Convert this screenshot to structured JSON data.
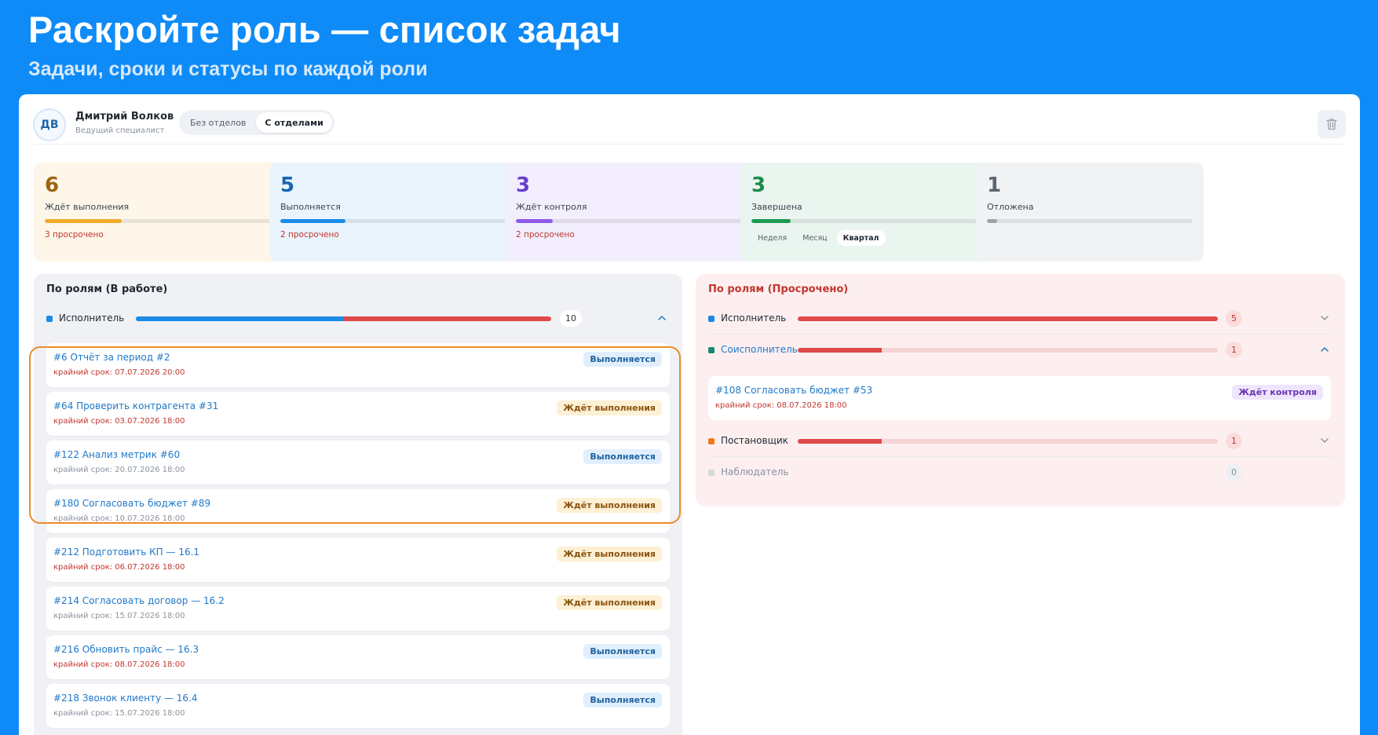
{
  "banner": {
    "title": "Раскройте роль — список задач",
    "subtitle": "Задачи, сроки и статусы по каждой роли"
  },
  "user": {
    "initials": "ДВ",
    "name": "Дмитрий Волков",
    "role": "Ведущий специалист"
  },
  "view_toggle": {
    "options": [
      "Без отделов",
      "С отделами"
    ],
    "selected": "С отделами"
  },
  "stats": [
    {
      "count": "6",
      "label": "Ждёт выполнения",
      "progress": 0.33,
      "overdue": "3 просрочено",
      "color": "#9c6512",
      "bar": "#f0ad2c",
      "bg": "#fdf6e9"
    },
    {
      "count": "5",
      "label": "Выполняется",
      "progress": 0.28,
      "overdue": "2 просрочено",
      "color": "#1a64b0",
      "bar": "#1a8be6",
      "bg": "#e9f4fd"
    },
    {
      "count": "3",
      "label": "Ждёт контроля",
      "progress": 0.16,
      "overdue": "2 просрочено",
      "color": "#6a3fc9",
      "bar": "#8f5be6",
      "bg": "#f2eefd"
    },
    {
      "count": "3",
      "label": "Завершена",
      "progress": 0.17,
      "overdue": "",
      "color": "#1d8a4c",
      "bar": "#1d9a54",
      "bg": "#ebf5f0"
    },
    {
      "count": "1",
      "label": "Отложена",
      "progress": 0.05,
      "overdue": "",
      "color": "#5d6670",
      "bar": "#9aa2ab",
      "bg": "#f1f2f4"
    }
  ],
  "period": {
    "options": [
      "Неделя",
      "Месяц",
      "Квартал"
    ],
    "selected": "Квартал"
  },
  "left_panel": {
    "title": "По ролям (В работе)",
    "role": {
      "name": "Исполнитель",
      "count": "10",
      "dot": "#1a8be6",
      "split": 0.5
    },
    "tasks": [
      {
        "title": "#6 Отчёт за период #2",
        "due": "крайний срок: 07.07.2026 20:00",
        "overdue": true,
        "status": "Выполняется",
        "kind": "running"
      },
      {
        "title": "#64 Проверить контрагента #31",
        "due": "крайний срок: 03.07.2026 18:00",
        "overdue": true,
        "status": "Ждёт выполнения",
        "kind": "waiting"
      },
      {
        "title": "#122 Анализ метрик #60",
        "due": "крайний срок: 20.07.2026 18:00",
        "overdue": false,
        "status": "Выполняется",
        "kind": "running"
      },
      {
        "title": "#180 Согласовать бюджет #89",
        "due": "крайний срок: 10.07.2026 18:00",
        "overdue": false,
        "status": "Ждёт выполнения",
        "kind": "waiting"
      },
      {
        "title": "#212 Подготовить КП — 16.1",
        "due": "крайний срок: 06.07.2026 18:00",
        "overdue": true,
        "status": "Ждёт выполнения",
        "kind": "waiting"
      },
      {
        "title": "#214 Согласовать договор — 16.2",
        "due": "крайний срок: 15.07.2026 18:00",
        "overdue": false,
        "status": "Ждёт выполнения",
        "kind": "waiting"
      },
      {
        "title": "#216 Обновить прайс — 16.3",
        "due": "крайний срок: 08.07.2026 18:00",
        "overdue": true,
        "status": "Выполняется",
        "kind": "running"
      },
      {
        "title": "#218 Звонок клиенту — 16.4",
        "due": "крайний срок: 15.07.2026 18:00",
        "overdue": false,
        "status": "Выполняется",
        "kind": "running"
      }
    ]
  },
  "right_panel": {
    "title": "По ролям (Просрочено)",
    "roles": [
      {
        "name": "Исполнитель",
        "count": "5",
        "dot": "#1a8be6",
        "fill": 1.0,
        "expanded": false
      },
      {
        "name": "Соисполнитель",
        "count": "1",
        "dot": "#168a76",
        "fill": 0.2,
        "expanded": true
      },
      {
        "name": "Постановщик",
        "count": "1",
        "dot": "#f07c19",
        "fill": 0.2,
        "expanded": false
      },
      {
        "name": "Наблюдатель",
        "count": "0",
        "dot": "#d5d8dd",
        "fill": 0,
        "expanded": false
      }
    ],
    "task": {
      "title": "#108 Согласовать бюджет #53",
      "due": "крайний срок: 08.07.2026 18:00",
      "status": "Ждёт контроля"
    }
  },
  "colors": {
    "accent": "#0e8bf7",
    "overdue_red": "#e0494a",
    "highlight": "#ea8c2a"
  }
}
